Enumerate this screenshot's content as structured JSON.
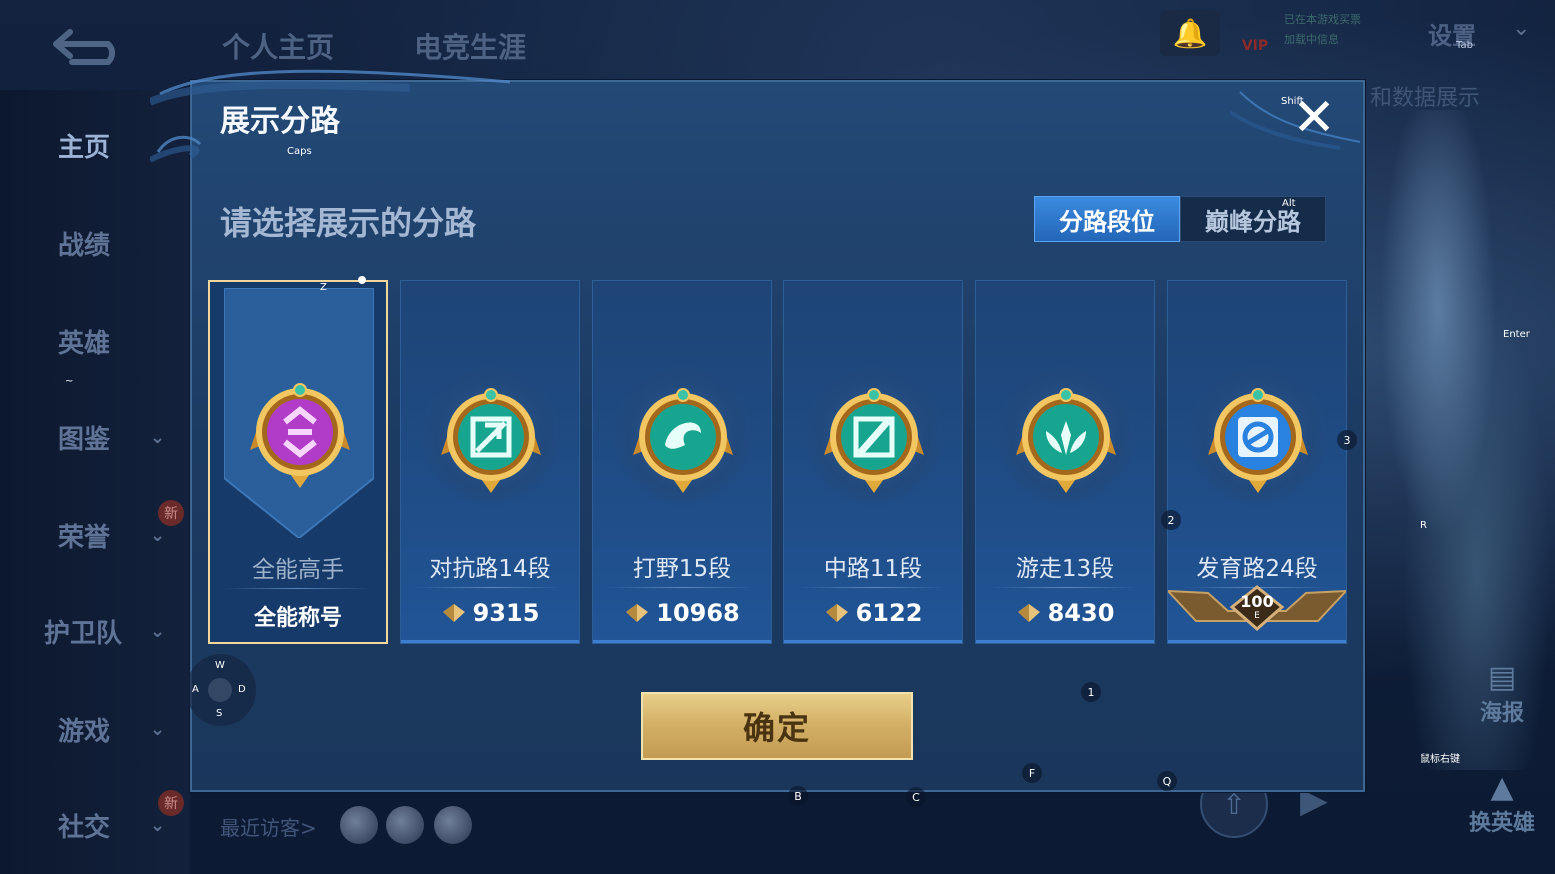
{
  "background": {
    "top_tabs": [
      "个人主页",
      "电竞生涯"
    ],
    "nav": [
      {
        "label": "主页",
        "active": true,
        "has_chevron": false,
        "new": false
      },
      {
        "label": "战绩",
        "active": false,
        "has_chevron": false,
        "new": false
      },
      {
        "label": "英雄",
        "active": false,
        "has_chevron": false,
        "new": false
      },
      {
        "label": "图鉴",
        "active": false,
        "has_chevron": true,
        "new": false
      },
      {
        "label": "荣誉",
        "active": false,
        "has_chevron": true,
        "new": true
      },
      {
        "label": "护卫队",
        "active": false,
        "has_chevron": true,
        "new": false
      },
      {
        "label": "游戏",
        "active": false,
        "has_chevron": true,
        "new": false
      },
      {
        "label": "社交",
        "active": false,
        "has_chevron": true,
        "new": true
      }
    ],
    "new_badge": "新",
    "settings_label": "设置",
    "settings_key": "Tab",
    "vip_label": "VIP",
    "status_lines": [
      "已在本游戏买票",
      "加载中信息"
    ],
    "side_text": "和数据展示",
    "side_buttons": [
      "海报",
      "换英雄"
    ],
    "recent_visitors": "最近访客>"
  },
  "modal": {
    "title": "展示分路",
    "subtitle": "请选择展示的分路",
    "segments": [
      "分路段位",
      "巅峰分路"
    ],
    "active_segment": 0,
    "confirm_label": "确定",
    "cards": [
      {
        "name": "全能高手",
        "score": "全能称号",
        "selected": true,
        "medal_color": "#b03cc8",
        "score_icon": false
      },
      {
        "name": "对抗路14段",
        "score": "9315",
        "selected": false,
        "medal_color": "#18a58f",
        "score_icon": true
      },
      {
        "name": "打野15段",
        "score": "10968",
        "selected": false,
        "medal_color": "#18a58f",
        "score_icon": true
      },
      {
        "name": "中路11段",
        "score": "6122",
        "selected": false,
        "medal_color": "#18a58f",
        "score_icon": true
      },
      {
        "name": "游走13段",
        "score": "8430",
        "selected": false,
        "medal_color": "#18a58f",
        "score_icon": true
      },
      {
        "name": "发育路24段",
        "score": "100",
        "selected": false,
        "medal_color": "#2a82e0",
        "score_icon": false
      }
    ]
  },
  "key_hints": {
    "caps": "Caps",
    "shift": "Shift",
    "alt": "Alt",
    "z": "Z",
    "enter": "Enter",
    "r": "R",
    "n3": "3",
    "n2": "2",
    "n1": "1",
    "f": "F",
    "q": "Q",
    "b": "B",
    "c": "C",
    "mouse_right": "鼠标右键",
    "tilde": "~",
    "joystick": [
      "W",
      "A",
      "S",
      "D"
    ],
    "crest_sub": "E"
  },
  "colors": {
    "accent_blue": "#2466b8",
    "gold": "#d4b167",
    "selected_border": "#f1d79a"
  }
}
